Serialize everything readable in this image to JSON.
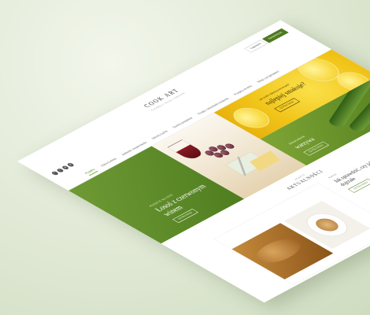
{
  "header": {
    "brand_name": "COOK ART",
    "brand_tagline": "KUCHNIA Z PASJĄ I SMAKIEM",
    "buttons": {
      "login": "Logowanie",
      "register": "Zarejestruj się"
    },
    "side_icon": "f",
    "socials": [
      {
        "icon": "facebook-icon",
        "glyph": "f"
      },
      {
        "icon": "twitter-icon",
        "glyph": "t"
      },
      {
        "icon": "google-icon",
        "glyph": "g"
      },
      {
        "icon": "pinterest-icon",
        "glyph": "p"
      }
    ]
  },
  "nav": {
    "items": [
      "Przepisy",
      "Dobra kuchnia",
      "Jedzenie i wspomnienia",
      "Sekrety kuchni",
      "Garstka przepisów",
      "Porady i wskazówki kuchenne",
      "Przepisy na wino",
      "Sklep z przyprawami"
    ]
  },
  "hero": {
    "main": {
      "kicker": "PRZEPIS NA DZIŚ",
      "title": "Łosoś z czerwonym winem",
      "button": "CZYTAJ DALEJ"
    },
    "right_top": {
      "kicker": "Jak zrobić najlepszą lemoniadę?",
      "title": "najlepiej smakuje?",
      "button": "CZYTAJ DALEJ"
    },
    "right_bottom": {
      "kicker": "Zdrowe jedzenie",
      "title": "warzywa",
      "button": "CZYTAJ DALEJ"
    }
  },
  "news": {
    "kicker": "ZOBACZ",
    "title": "AKTUALNOŚCI",
    "card2": {
      "kicker": "PORADY",
      "title": "Jak sprawdzić, czy jajko jest dojrzałe",
      "button": "CZYTAJ DALEJ"
    }
  },
  "colors": {
    "brand_green": "#4d7a1e",
    "accent_lime": "#8ab53a",
    "yellow": "#f1c51a",
    "wine": "#8a1b22"
  }
}
